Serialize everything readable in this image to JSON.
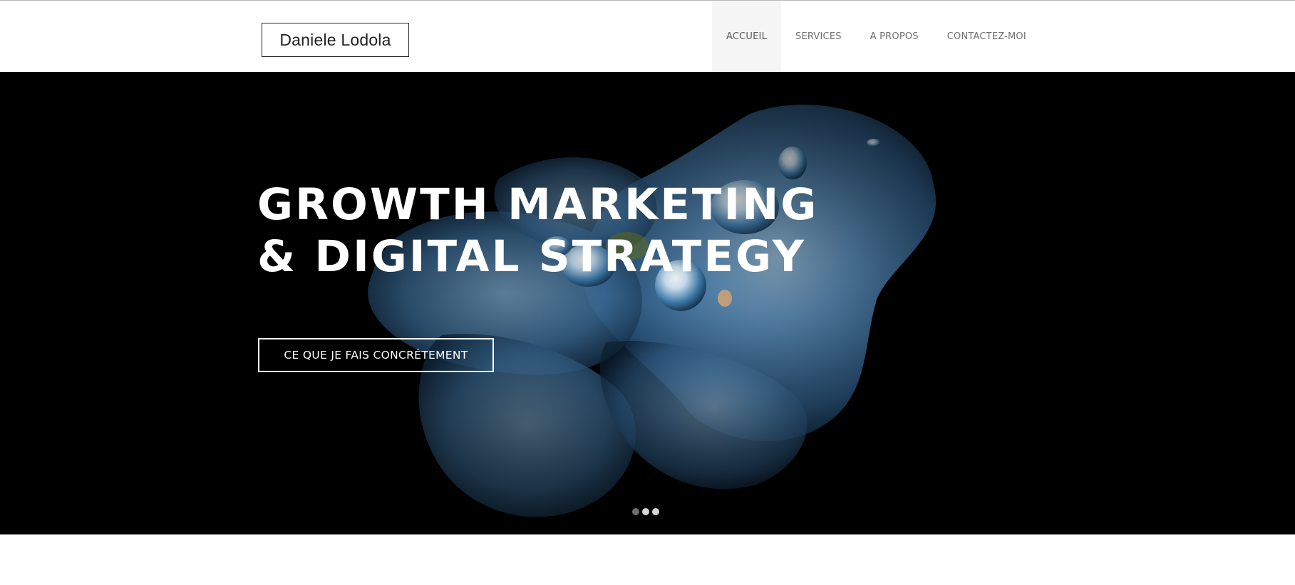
{
  "header": {
    "logo_text": "Daniele Lodola",
    "nav": [
      {
        "label": "ACCUEIL",
        "active": true
      },
      {
        "label": "SERVICES",
        "active": false
      },
      {
        "label": "A PROPOS",
        "active": false
      },
      {
        "label": "CONTACTEZ-MOI",
        "active": false
      }
    ]
  },
  "hero": {
    "headline_line1": "GROWTH MARKETING",
    "headline_line2": "& DIGITAL STRATEGY",
    "cta_label": "CE QUE JE FAIS CONCRÉTEMENT",
    "slider": {
      "total_slides": 3,
      "active_slide": 1
    }
  },
  "colors": {
    "header_bg": "#ffffff",
    "hero_bg": "#000000",
    "nav_text": "#6f6f6f",
    "nav_active_bg": "#f5f5f5",
    "petal_blue": "#4f86b3",
    "hero_text": "#ffffff"
  }
}
